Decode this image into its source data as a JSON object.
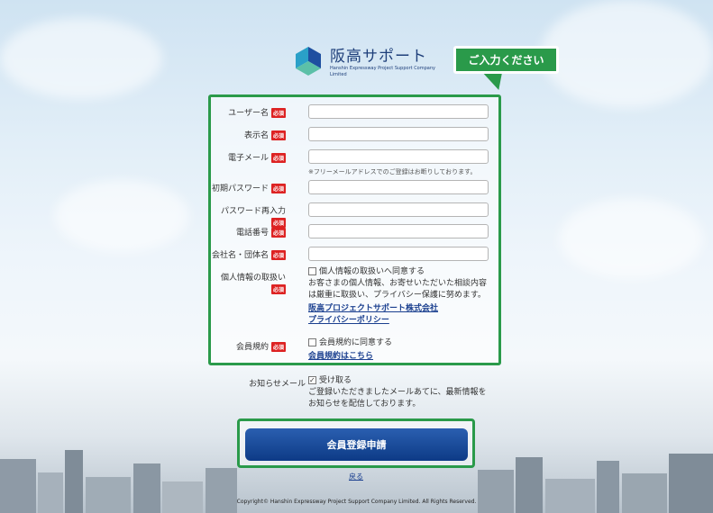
{
  "logo": {
    "name": "阪高サポート",
    "sub": "Hanshin Expressway Project Support Company Limited"
  },
  "bubble": "ご入力ください",
  "required_label": "必須",
  "fields": {
    "username": "ユーザー名",
    "display_name": "表示名",
    "email": "電子メール",
    "email_note": "※フリーメールアドレスでのご登録はお断りしております。",
    "initial_password": "初期パスワード",
    "password_confirm": "パスワード再入力",
    "phone": "電話番号",
    "company": "会社名・団体名",
    "privacy": "個人情報の取扱い",
    "terms": "会員規約",
    "newsletter": "お知らせメール"
  },
  "privacy": {
    "checkbox_label": "個人情報の取扱いへ同意する",
    "text": "お客さまの個人情報、お寄せいただいた相談内容は厳重に取扱い、プライバシー保護に努めます。",
    "company_link": "阪高プロジェクトサポート株式会社",
    "policy_link": "プライバシーポリシー"
  },
  "terms": {
    "checkbox_label": "会員規約に同意する",
    "link": "会員規約はこちら"
  },
  "newsletter": {
    "checkbox_label": "受け取る",
    "checked": true,
    "text": "ご登録いただきましたメールあてに、最新情報をお知らせを配信しております。"
  },
  "submit_label": "会員登録申請",
  "back_label": "戻る",
  "copyright": "Copyright© Hanshin Expressway Project Support Company Limited. All Rights Reserved.",
  "colors": {
    "accent_green": "#2a9a4a",
    "required_red": "#dd2222",
    "button_blue": "#0d3a86",
    "link_blue": "#1a3f8f"
  }
}
